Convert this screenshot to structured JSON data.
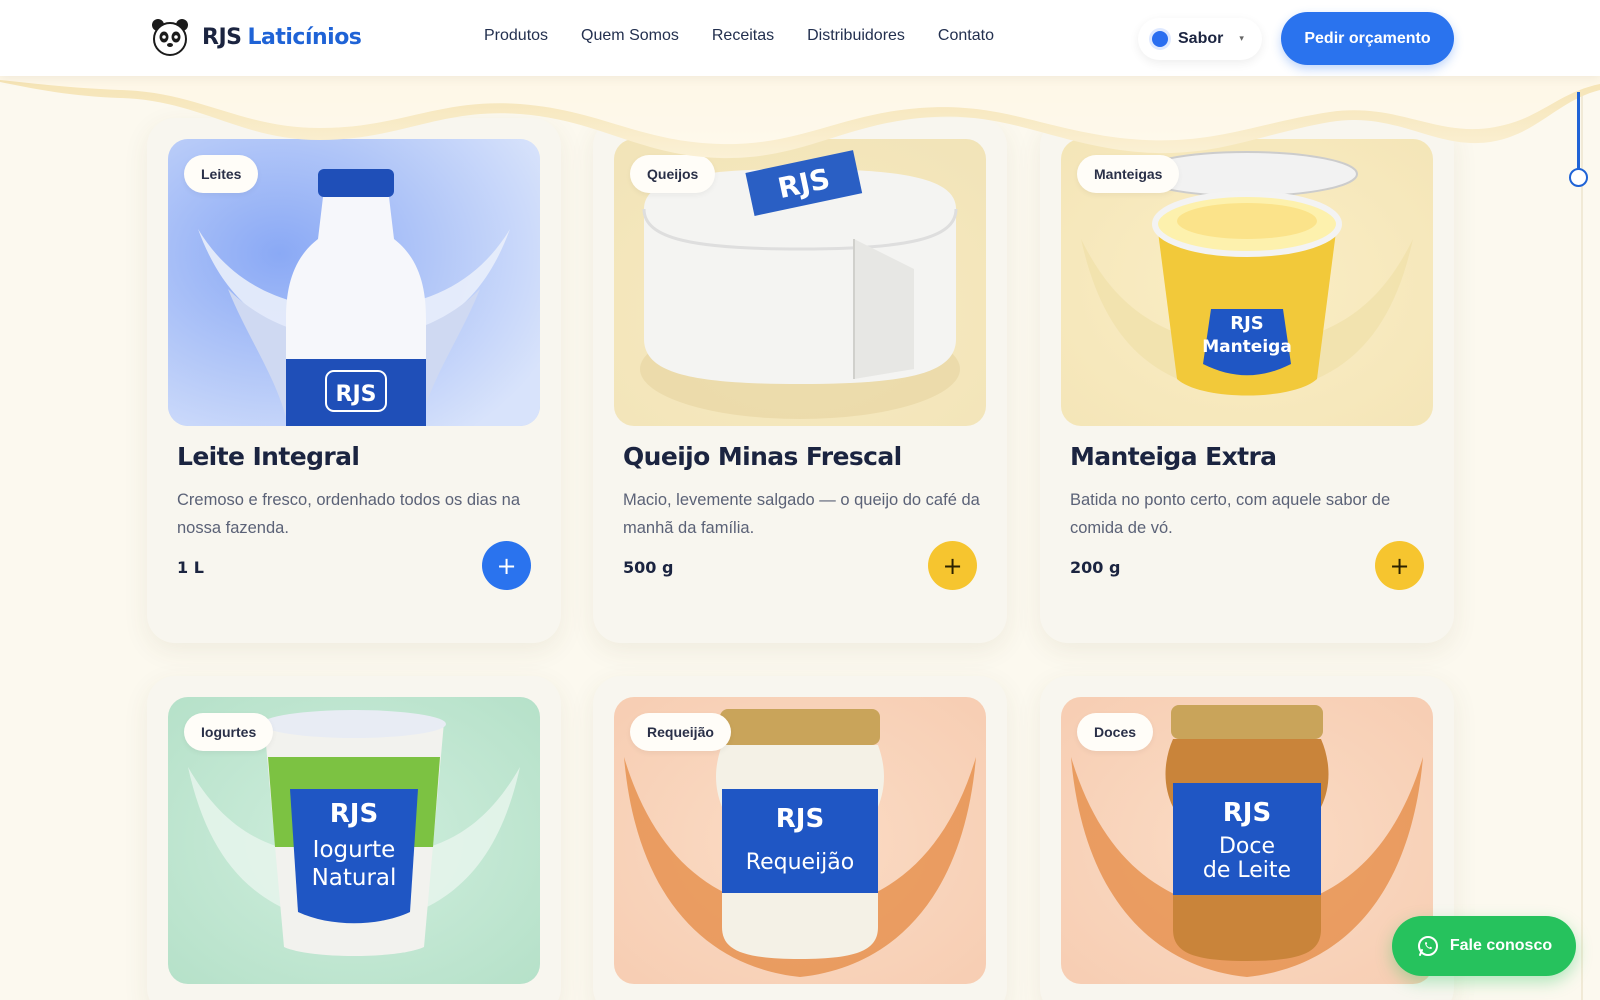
{
  "brand": {
    "name_part1": "RJS",
    "name_part2": "Laticínios",
    "logo_icon": "panda-logo-icon"
  },
  "nav": {
    "items": [
      "Produtos",
      "Quem Somos",
      "Receitas",
      "Distribuidores",
      "Contato"
    ]
  },
  "flavor_selector": {
    "label": "Sabor",
    "color": "#2a6ef0"
  },
  "header_cta": {
    "label": "Pedir orçamento"
  },
  "products": [
    {
      "category": "Leites",
      "title": "Leite Integral",
      "description": "Cremoso e fresco, ordenhado todos os dias na nossa fazenda.",
      "size": "1 L",
      "add_label": "+",
      "label_text": "RJS"
    },
    {
      "category": "Queijos",
      "title": "Queijo Minas Frescal",
      "description": "Macio, levemente salgado — o queijo do café da manhã da família.",
      "size": "500 g",
      "add_label": "+",
      "label_text": "RJS"
    },
    {
      "category": "Manteigas",
      "title": "Manteiga Extra",
      "description": "Batida no ponto certo, com aquele sabor de comida de vó.",
      "size": "200 g",
      "add_label": "+",
      "label_text": "RJS",
      "label_sub": "Manteiga"
    },
    {
      "category": "Iogurtes",
      "label_text": "RJS",
      "label_sub1": "Iogurte",
      "label_sub2": "Natural"
    },
    {
      "category": "Requeijão",
      "label_text": "RJS",
      "label_sub": "Requeijão"
    },
    {
      "category": "Doces",
      "label_text": "RJS",
      "label_sub1": "Doce",
      "label_sub2": "de Leite"
    }
  ],
  "whatsapp": {
    "label": "Fale conosco"
  },
  "colors": {
    "accent_blue": "#2a73ee",
    "accent_yellow": "#f6c52f",
    "whatsapp_green": "#26c25d",
    "background": "#fcf9ef"
  }
}
